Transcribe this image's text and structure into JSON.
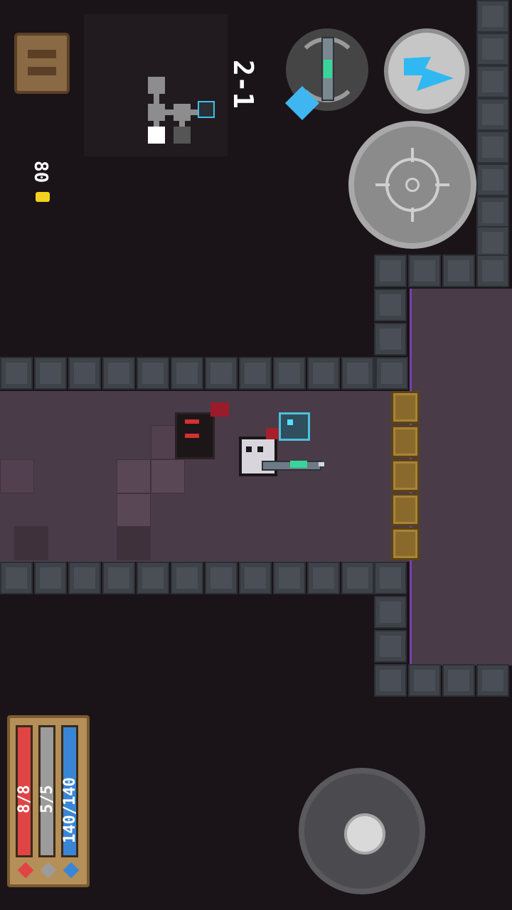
{
  "hud": {
    "level": "2-1",
    "coins": "80",
    "health": "8/8",
    "armor": "5/5",
    "energy": "140/140"
  },
  "colors": {
    "health": "#e04444",
    "armor": "#9c9c9c",
    "energy": "#3a86d6",
    "skill_bolt": "#2fb8f2",
    "coin": "#f2d11f"
  },
  "icons": {
    "pause": "pause-icon",
    "skill": "lightning-bolt-icon",
    "aim": "crosshair-icon",
    "swap": "weapon-swap-icon",
    "coin": "coin-icon",
    "health": "heart-icon",
    "armor": "shield-icon",
    "energy": "diamond-icon"
  }
}
